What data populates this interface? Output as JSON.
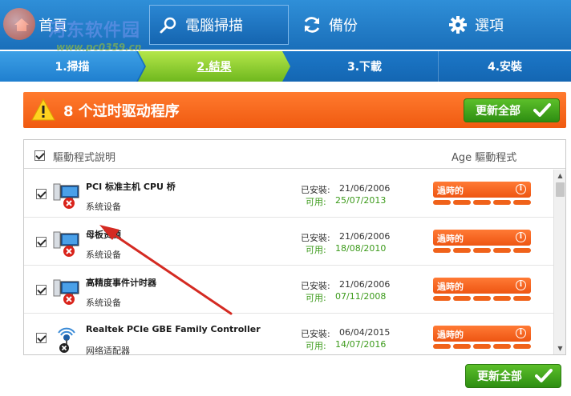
{
  "nav": {
    "home_label": "首頁",
    "scan_label": "電腦掃描",
    "backup_label": "備份",
    "options_label": "選項"
  },
  "watermark": {
    "text": "河东软件园",
    "url": "www.pc0359.cn"
  },
  "steps": [
    {
      "label": "1.掃描"
    },
    {
      "label": "2.結果"
    },
    {
      "label": "3.下載"
    },
    {
      "label": "4.安裝"
    }
  ],
  "banner": {
    "title": "8 个过时驱动程序",
    "update_all_label": "更新全部"
  },
  "list_header": {
    "description_label": "驅動程式說明",
    "age_label": "Age 驅動程式"
  },
  "rows": [
    {
      "name": "PCI 标准主机 CPU 桥",
      "category": "系统设备",
      "installed_label": "已安裝:",
      "installed": "21/06/2006",
      "available_label": "可用:",
      "available": "25/07/2013",
      "status": "過時的",
      "icon": "computer-device-icon"
    },
    {
      "name": "母板资源",
      "category": "系统设备",
      "installed_label": "已安裝:",
      "installed": "21/06/2006",
      "available_label": "可用:",
      "available": "18/08/2010",
      "status": "過時的",
      "icon": "computer-device-icon"
    },
    {
      "name": "高精度事件计时器",
      "category": "系统设备",
      "installed_label": "已安裝:",
      "installed": "21/06/2006",
      "available_label": "可用:",
      "available": "07/11/2008",
      "status": "過時的",
      "icon": "computer-device-icon"
    },
    {
      "name": "Realtek PCIe GBE Family Controller",
      "category": "网络适配器",
      "installed_label": "已安裝:",
      "installed": "06/04/2015",
      "available_label": "可用:",
      "available": "14/07/2016",
      "status": "過時的",
      "icon": "network-adapter-icon"
    }
  ],
  "footer": {
    "update_all_label": "更新全部"
  },
  "colors": {
    "nav_blue": "#1a6fba",
    "active_step_green": "#8ccc2e",
    "banner_orange": "#f05a10",
    "button_green": "#3a9e18",
    "available_green": "#3b9a1a",
    "error_red": "#d9231a"
  }
}
